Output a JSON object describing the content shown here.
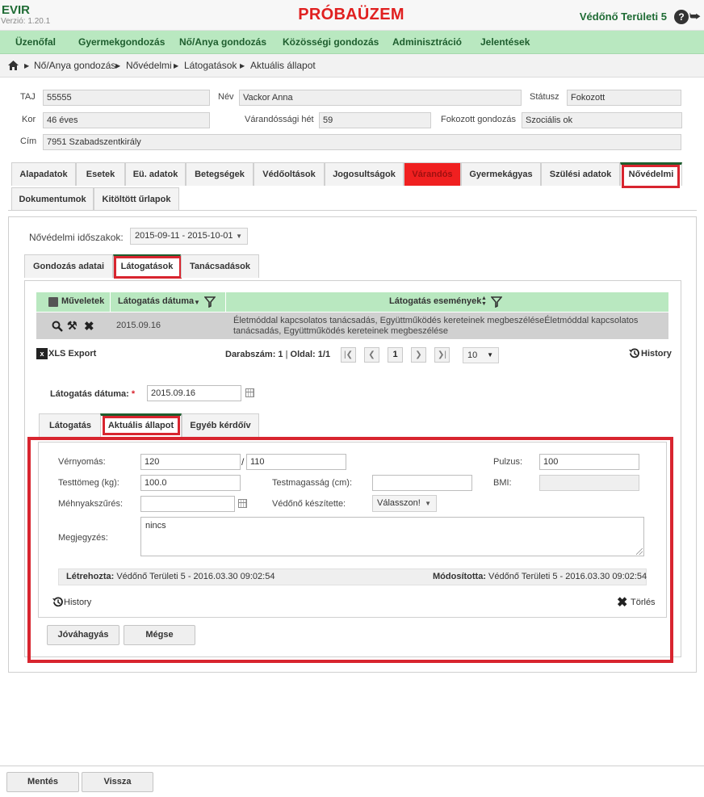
{
  "app": {
    "name": "EVIR",
    "version": "Verzió: 1.20.1",
    "banner": "PRÓBAÜZEM",
    "user": "Védőnő Területi 5",
    "help_icon": "?",
    "logout_icon": "logout-icon"
  },
  "nav": {
    "items": [
      "Üzenőfal",
      "Gyermekgondozás",
      "Nő/Anya gondozás",
      "Közösségi gondozás",
      "Adminisztráció",
      "Jelentések"
    ]
  },
  "breadcrumb": {
    "home_icon": "home-icon",
    "items": [
      "Nő/Anya gondozás",
      "Nővédelmi",
      "Látogatások",
      "Aktuális állapot"
    ]
  },
  "patient": {
    "taj_label": "TAJ",
    "taj": "55555",
    "name_label": "Név",
    "name": "Vackor Anna",
    "status_label": "Státusz",
    "status": "Fokozott",
    "age_label": "Kor",
    "age": "46 éves",
    "week_label": "Várandóssági hét",
    "week": "59",
    "care_label": "Fokozott gondozás",
    "care": "Szociális ok",
    "address_label": "Cím",
    "address": "7951 Szabadszentkirály"
  },
  "main_tabs": [
    "Alapadatok",
    "Esetek",
    "Eü. adatok",
    "Betegségek",
    "Védőoltások",
    "Jogosultságok",
    "Várandós",
    "Gyermekágyas",
    "Szülési adatok",
    "Nővédelmi",
    "Dokumentumok",
    "Kitöltött űrlapok"
  ],
  "periods": {
    "label": "Nővédelmi időszakok:",
    "selected": "2015-09-11 - 2015-10-01"
  },
  "sub_tabs": [
    "Gondozás adatai",
    "Látogatások",
    "Tanácsadások"
  ],
  "grid": {
    "col_actions": "Műveletek",
    "col_date": "Látogatás dátuma",
    "col_events": "Látogatás események",
    "rows": [
      {
        "date": "2015.09.16",
        "events": "Életmóddal kapcsolatos tanácsadás, Együttműködés kereteinek megbeszéléseÉletmóddal kapcsolatos tanácsadás, Együttműködés kereteinek megbeszélése"
      }
    ],
    "xls_export": "XLS Export",
    "count_label": "Darabszám:",
    "count": "1",
    "page_label": "Oldal:",
    "page": "1/1",
    "current_page": "1",
    "page_size": "10",
    "history": "History"
  },
  "visit": {
    "date_label": "Látogatás dátuma:",
    "required_mark": "*",
    "date": "2015.09.16",
    "tabs": [
      "Látogatás",
      "Aktuális állapot",
      "Egyéb kérdőív"
    ]
  },
  "state": {
    "bp_label": "Vérnyomás:",
    "bp_sys": "120",
    "bp_sep": "/",
    "bp_dia": "110",
    "pulse_label": "Pulzus:",
    "pulse": "100",
    "weight_label": "Testtömeg (kg):",
    "weight": "100.0",
    "height_label": "Testmagasság (cm):",
    "height": "",
    "bmi_label": "BMI:",
    "bmi": "",
    "screen_label": "Méhnyakszűrés:",
    "screen": "",
    "nurse_label": "Védőnő készítette:",
    "nurse_select": "Válasszon!",
    "note_label": "Megjegyzés:",
    "note": "nincs",
    "created_label": "Létrehozta:",
    "created": "Védőnő Területi 5 - 2016.03.30 09:02:54",
    "modified_label": "Módosította:",
    "modified": "Védőnő Területi 5 - 2016.03.30 09:02:54",
    "history": "History",
    "delete": "Törlés",
    "approve": "Jóváhagyás",
    "cancel": "Mégse"
  },
  "footer": {
    "save": "Mentés",
    "back": "Vissza"
  },
  "colors": {
    "accent": "#1e5e2e",
    "nav_bg": "#b9e8c0",
    "banner": "#e02020",
    "highlight": "#d8252f"
  }
}
